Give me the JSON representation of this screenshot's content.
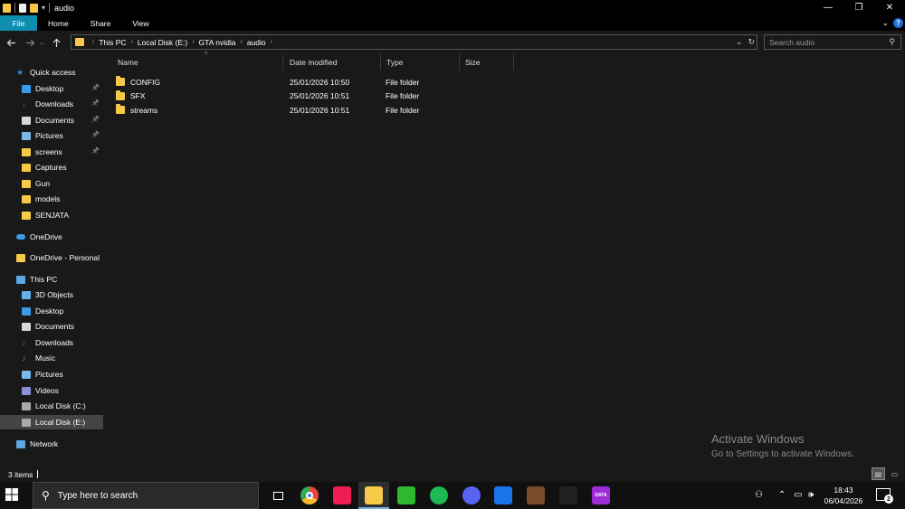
{
  "window": {
    "title": "audio",
    "minimize_glyph": "—",
    "maximize_glyph": "❐",
    "close_glyph": "✕"
  },
  "ribbon": {
    "tabs": [
      {
        "label": "File"
      },
      {
        "label": "Home"
      },
      {
        "label": "Share"
      },
      {
        "label": "View"
      }
    ],
    "accent": "#0f8fb0",
    "help_glyph": "?"
  },
  "address": {
    "crumbs": [
      "This PC",
      "Local Disk (E:)",
      "GTA nvidia",
      "audio"
    ]
  },
  "search": {
    "placeholder": "Search audio"
  },
  "sidebar": {
    "items": [
      {
        "label": "Quick access",
        "icon": "star-icon",
        "pinned": false
      },
      {
        "label": "Desktop",
        "icon": "desktop-icon",
        "pinned": true
      },
      {
        "label": "Downloads",
        "icon": "downloads-icon",
        "pinned": true
      },
      {
        "label": "Documents",
        "icon": "documents-icon",
        "pinned": true
      },
      {
        "label": "Pictures",
        "icon": "pictures-icon",
        "pinned": true
      },
      {
        "label": "screens",
        "icon": "folder-icon",
        "pinned": true
      },
      {
        "label": "Captures",
        "icon": "folder-icon",
        "pinned": false
      },
      {
        "label": "Gun",
        "icon": "folder-icon",
        "pinned": false
      },
      {
        "label": "models",
        "icon": "folder-icon",
        "pinned": false
      },
      {
        "label": "SENJATA",
        "icon": "folder-icon",
        "pinned": false
      },
      {
        "label": "OneDrive",
        "icon": "cloud-icon",
        "pinned": false
      },
      {
        "label": "OneDrive - Personal",
        "icon": "folder-icon",
        "pinned": false
      },
      {
        "label": "This PC",
        "icon": "computer-icon",
        "pinned": false
      },
      {
        "label": "3D Objects",
        "icon": "3d-objects-icon",
        "pinned": false
      },
      {
        "label": "Desktop",
        "icon": "desktop-icon",
        "pinned": false
      },
      {
        "label": "Documents",
        "icon": "documents-icon",
        "pinned": false
      },
      {
        "label": "Downloads",
        "icon": "downloads-icon",
        "pinned": false
      },
      {
        "label": "Music",
        "icon": "music-icon",
        "pinned": false
      },
      {
        "label": "Pictures",
        "icon": "pictures-icon",
        "pinned": false
      },
      {
        "label": "Videos",
        "icon": "videos-icon",
        "pinned": false
      },
      {
        "label": "Local Disk (C:)",
        "icon": "drive-icon",
        "pinned": false
      },
      {
        "label": "Local Disk (E:)",
        "icon": "drive-icon",
        "pinned": false,
        "selected": true
      },
      {
        "label": "Network",
        "icon": "network-icon",
        "pinned": false
      }
    ]
  },
  "columns": [
    {
      "label": "Name"
    },
    {
      "label": "Date modified"
    },
    {
      "label": "Type"
    },
    {
      "label": "Size"
    }
  ],
  "files": [
    {
      "name": "CONFIG",
      "date": "25/01/2026 10:50",
      "type": "File folder",
      "size": ""
    },
    {
      "name": "SFX",
      "date": "25/01/2026 10:51",
      "type": "File folder",
      "size": ""
    },
    {
      "name": "streams",
      "date": "25/01/2026 10:51",
      "type": "File folder",
      "size": ""
    }
  ],
  "watermark": {
    "line1": "Activate Windows",
    "line2": "Go to Settings to activate Windows."
  },
  "status": {
    "items_count": "3 items"
  },
  "taskbar": {
    "search_text": "Type here to search",
    "apps": [
      {
        "name": "task-view-icon",
        "color": "#101010",
        "label": ""
      },
      {
        "name": "chrome-icon",
        "color": "#e8453c",
        "label": ""
      },
      {
        "name": "tiktok-icon",
        "color": "#ee1d52",
        "label": ""
      },
      {
        "name": "file-explorer-icon",
        "color": "#f7c948",
        "label": ""
      },
      {
        "name": "app-green-icon",
        "color": "#2eb82e",
        "label": ""
      },
      {
        "name": "spotify-icon",
        "color": "#1db954",
        "label": ""
      },
      {
        "name": "discord-icon",
        "color": "#5865f2",
        "label": ""
      },
      {
        "name": "roblox-icon",
        "color": "#1a73e8",
        "label": ""
      },
      {
        "name": "game-icon",
        "color": "#7a4a2a",
        "label": ""
      },
      {
        "name": "capcut-icon",
        "color": "#222222",
        "label": ""
      },
      {
        "name": "app-purple-icon",
        "color": "#9b2cd6",
        "label": "DATA"
      }
    ],
    "time": "18:43",
    "date": "06/04/2026",
    "notifications": "2"
  }
}
